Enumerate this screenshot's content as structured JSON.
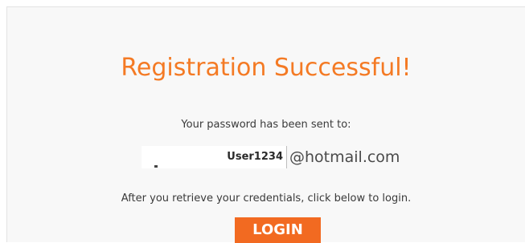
{
  "header": {
    "title": "Registration Successful!"
  },
  "message": {
    "sent_to": "Your password has been sent to:",
    "username": "User1234",
    "email_domain": "@hotmail.com",
    "instructions": "After you retrieve your credentials, click below to login."
  },
  "actions": {
    "login_label": "LOGIN"
  },
  "colors": {
    "accent": "#f47a24",
    "button": "#f26a21",
    "panel_background": "#f8f8f8",
    "text": "#3a3a3a"
  }
}
